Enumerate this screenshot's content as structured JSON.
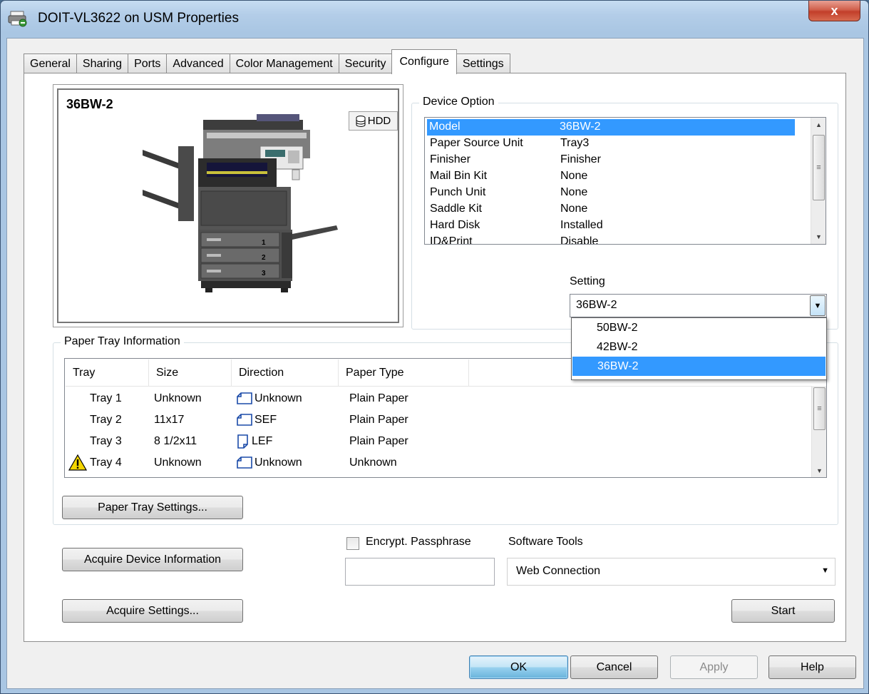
{
  "window": {
    "title": "DOIT-VL3622 on USM Properties",
    "close_label": "x"
  },
  "tabs": [
    {
      "label": "General",
      "active": false
    },
    {
      "label": "Sharing",
      "active": false
    },
    {
      "label": "Ports",
      "active": false
    },
    {
      "label": "Advanced",
      "active": false
    },
    {
      "label": "Color Management",
      "active": false
    },
    {
      "label": "Security",
      "active": false
    },
    {
      "label": "Configure",
      "active": true
    },
    {
      "label": "Settings",
      "active": false
    }
  ],
  "device": {
    "model_label": "36BW-2",
    "hdd_badge": "HDD",
    "tray_numbers": [
      "1",
      "2",
      "3"
    ]
  },
  "device_option": {
    "label": "Device Option",
    "rows": [
      {
        "name": "Model",
        "value": "36BW-2",
        "selected": true
      },
      {
        "name": "Paper Source Unit",
        "value": "Tray3"
      },
      {
        "name": "Finisher",
        "value": "Finisher"
      },
      {
        "name": "Mail Bin Kit",
        "value": "None"
      },
      {
        "name": "Punch Unit",
        "value": "None"
      },
      {
        "name": "Saddle Kit",
        "value": "None"
      },
      {
        "name": "Hard Disk",
        "value": "Installed"
      },
      {
        "name": "ID&Print",
        "value": "Disable"
      }
    ],
    "setting_label": "Setting",
    "setting_value": "36BW-2",
    "setting_options": [
      {
        "label": "50BW-2",
        "selected": false
      },
      {
        "label": "42BW-2",
        "selected": false
      },
      {
        "label": "36BW-2",
        "selected": true
      }
    ]
  },
  "paper_tray": {
    "label": "Paper Tray Information",
    "columns": [
      "Tray",
      "Size",
      "Direction",
      "Paper Type"
    ],
    "rows": [
      {
        "tray": "Tray 1",
        "size": "Unknown",
        "direction": "Unknown",
        "paper_type": "Plain Paper",
        "warning": false,
        "orient": "landscape"
      },
      {
        "tray": "Tray 2",
        "size": "11x17",
        "direction": "SEF",
        "paper_type": "Plain Paper",
        "warning": false,
        "orient": "landscape"
      },
      {
        "tray": "Tray 3",
        "size": "8 1/2x11",
        "direction": "LEF",
        "paper_type": "Plain Paper",
        "warning": false,
        "orient": "portrait"
      },
      {
        "tray": "Tray 4",
        "size": "Unknown",
        "direction": "Unknown",
        "paper_type": "Unknown",
        "warning": true,
        "orient": "landscape"
      }
    ],
    "settings_button": "Paper Tray Settings..."
  },
  "actions": {
    "acquire_device_info": "Acquire Device Information",
    "acquire_settings": "Acquire Settings...",
    "encrypt_label": "Encrypt. Passphrase",
    "encrypt_checked": false,
    "passphrase_value": "",
    "software_tools_label": "Software Tools",
    "software_tools_value": "Web Connection",
    "start": "Start"
  },
  "footer": {
    "ok": "OK",
    "cancel": "Cancel",
    "apply": "Apply",
    "help": "Help"
  },
  "colors": {
    "selection": "#3399ff",
    "title_gradient": "#b3cde8",
    "close_button": "#c23e2a"
  }
}
